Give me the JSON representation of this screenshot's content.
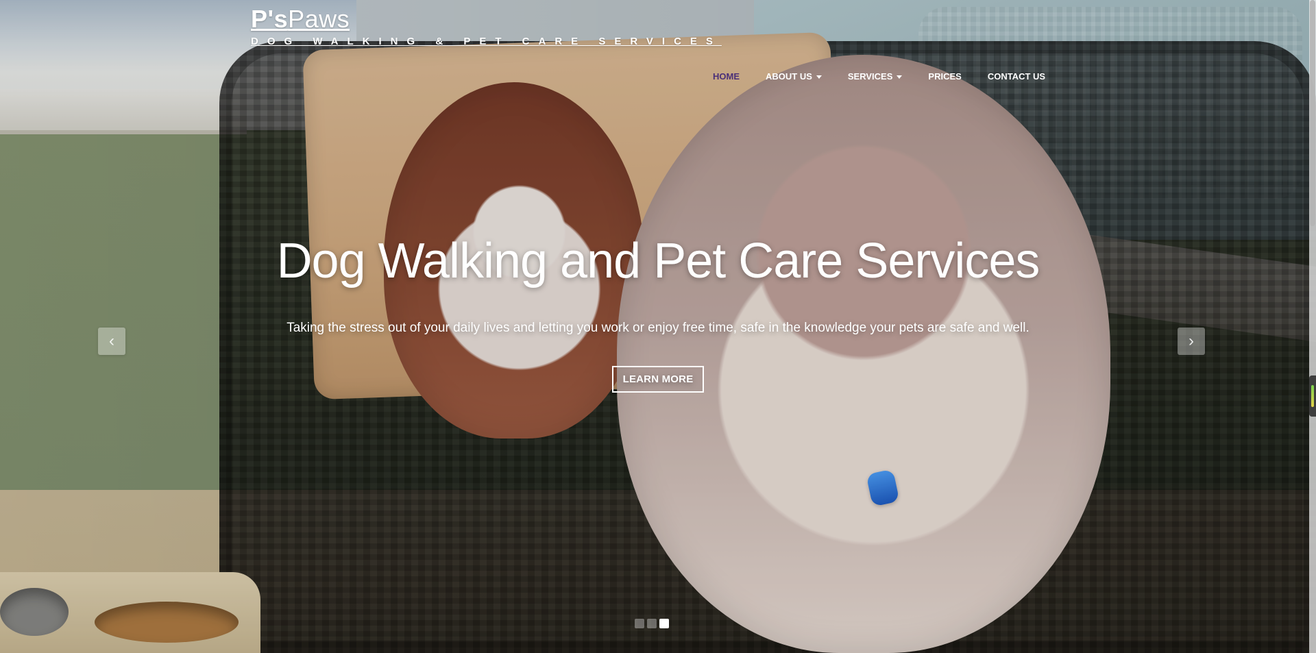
{
  "brand": {
    "title_strong": "P's",
    "title_light": "Paws",
    "subtitle": "DOG WALKING & PET CARE SERVICES"
  },
  "nav": {
    "items": [
      {
        "label": "HOME",
        "active": true
      },
      {
        "label": "ABOUT US",
        "has_caret": true
      },
      {
        "label": "SERVICES",
        "has_caret": true
      },
      {
        "label": "PRICES"
      },
      {
        "label": "CONTACT US"
      }
    ]
  },
  "hero": {
    "title": "Dog Walking and Pet Care Services",
    "subtitle": "Taking the stress out of your daily lives and letting you work or enjoy free time, safe in the knowledge your pets are safe and well.",
    "cta": "LEARN MORE"
  },
  "carousel": {
    "prev_icon": "chevron-left-icon",
    "next_icon": "chevron-right-icon",
    "slides": 3,
    "active_index": 2
  }
}
